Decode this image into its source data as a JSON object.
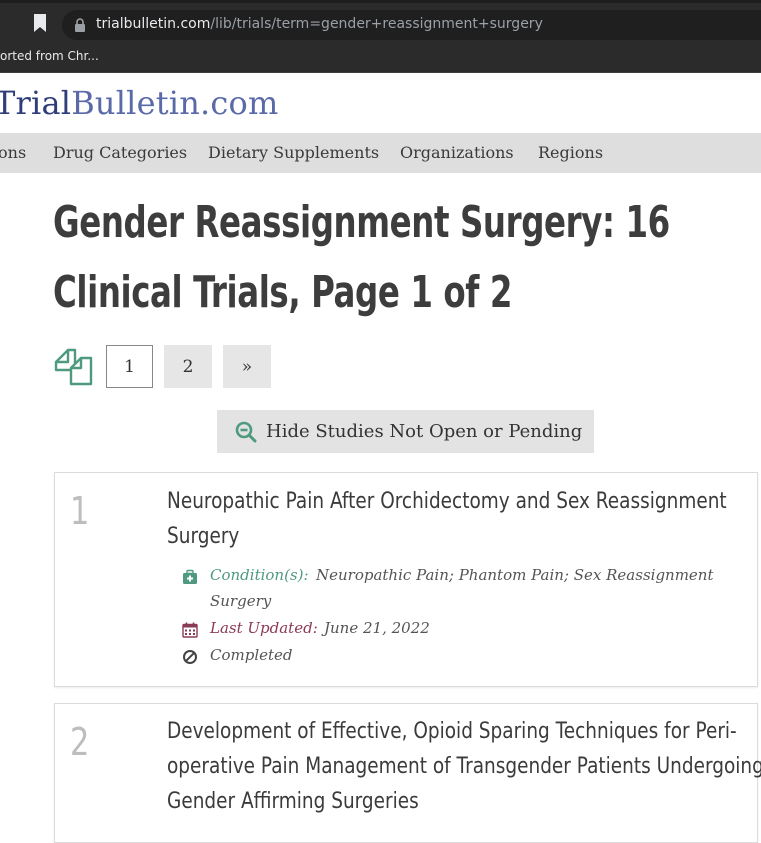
{
  "browser": {
    "url_host": "trialbulletin.com",
    "url_path": "/lib/trials/term=gender+reassignment+surgery",
    "bookmark_item": "orted from Chr..."
  },
  "site": {
    "logo_part1": "Trial",
    "logo_part2": "Bulletin.com",
    "nav": [
      "ons",
      "Drug Categories",
      "Dietary Supplements",
      "Organizations",
      "Regions"
    ]
  },
  "page": {
    "title_line1": "Gender Reassignment Surgery: 16",
    "title_line2": "Clinical Trials, Page 1 of 2"
  },
  "pagination": {
    "pages": [
      "1",
      "2"
    ],
    "next": "»",
    "current": "1"
  },
  "filter_button": "Hide Studies Not Open or Pending",
  "trials": [
    {
      "number": "1",
      "title_line1": "Neuropathic Pain After Orchidectomy and Sex Reassignment",
      "title_line2": "Surgery",
      "condition_label": "Condition(s):",
      "condition_value_line1": "Neuropathic Pain; Phantom Pain; Sex Reassignment",
      "condition_value_line2": "Surgery",
      "updated_label": "Last Updated:",
      "updated_value": "June 21, 2022",
      "status": "Completed"
    },
    {
      "number": "2",
      "title_line1": "Development of Effective, Opioid Sparing Techniques for Peri-",
      "title_line2": "operative Pain Management of Transgender Patients Undergoing",
      "title_line3": "Gender Affirming Surgeries"
    }
  ],
  "colors": {
    "logo_dark": "#2f3d78",
    "logo_light": "#5a6aa8",
    "condition_green": "#4f9a7f",
    "date_maroon": "#8b3a55"
  }
}
